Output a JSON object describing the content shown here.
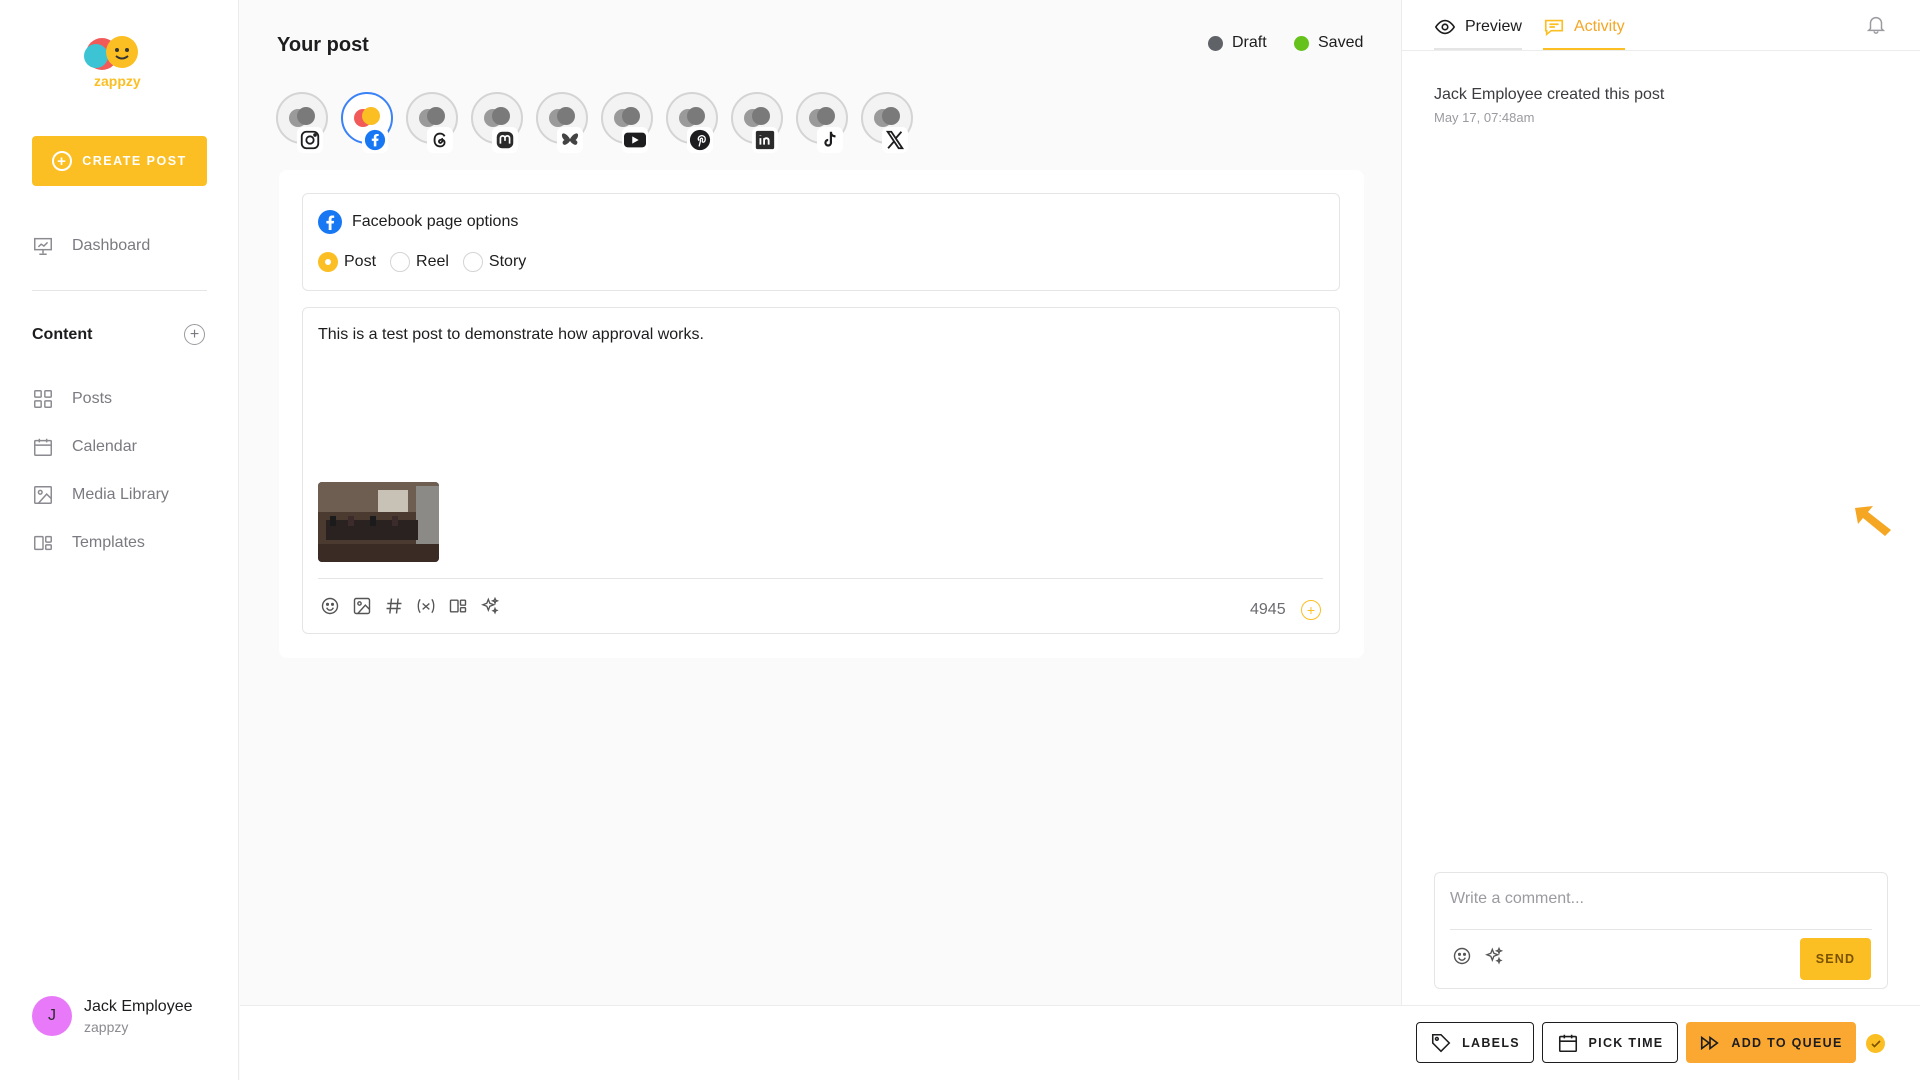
{
  "sidebar": {
    "logo_text": "zappzy",
    "create_post": "CREATE POST",
    "dashboard": "Dashboard",
    "content_title": "Content",
    "items": [
      {
        "label": "Posts",
        "icon": "grid-icon"
      },
      {
        "label": "Calendar",
        "icon": "calendar-icon"
      },
      {
        "label": "Media Library",
        "icon": "image-icon"
      },
      {
        "label": "Templates",
        "icon": "templates-icon"
      }
    ],
    "user": {
      "initial": "J",
      "name": "Jack Employee",
      "org": "zappzy"
    }
  },
  "header": {
    "title": "Your post",
    "status": [
      {
        "label": "Draft",
        "color": "#5f6368"
      },
      {
        "label": "Saved",
        "color": "#65c21b"
      }
    ]
  },
  "accounts": [
    {
      "network": "instagram",
      "active": false
    },
    {
      "network": "facebook",
      "active": true
    },
    {
      "network": "threads",
      "active": false
    },
    {
      "network": "mastodon",
      "active": false
    },
    {
      "network": "bluesky",
      "active": false
    },
    {
      "network": "youtube",
      "active": false
    },
    {
      "network": "pinterest",
      "active": false
    },
    {
      "network": "linkedin",
      "active": false
    },
    {
      "network": "tiktok",
      "active": false
    },
    {
      "network": "x",
      "active": false
    }
  ],
  "facebook_options": {
    "title": "Facebook page options",
    "types": [
      "Post",
      "Reel",
      "Story"
    ],
    "selected": "Post"
  },
  "editor": {
    "text": "This is a test post to demonstrate how approval works.",
    "char_count": "4945"
  },
  "right_panel": {
    "tabs": {
      "preview": "Preview",
      "activity": "Activity"
    },
    "active_tab": "Activity",
    "activity": {
      "text": "Jack Employee created this post",
      "time": "May 17, 07:48am"
    },
    "comment_placeholder": "Write a comment...",
    "send": "SEND"
  },
  "bottom_bar": {
    "labels": "LABELS",
    "pick_time": "PICK TIME",
    "add_to_queue": "ADD TO QUEUE"
  },
  "colors": {
    "accent": "#fbbf24",
    "facebook": "#1877f2",
    "queue": "#fba832"
  }
}
